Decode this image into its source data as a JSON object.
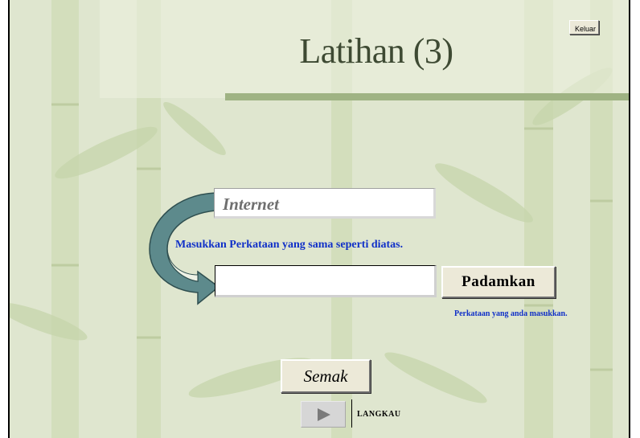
{
  "window": {
    "title": "Latihan (3)"
  },
  "header": {
    "exit_label": "Keluar"
  },
  "exercise": {
    "word": "Internet",
    "instruction": "Masukkan Perkataan yang sama seperti diatas.",
    "input_value": "",
    "clear_label": "Padamkan",
    "hint": "Perkataan yang anda masukkan.",
    "check_label": "Semak"
  },
  "footer": {
    "skip_label": "LANGKAU"
  },
  "colors": {
    "background": "#dfe6cf",
    "title_text": "#3e4a33",
    "instruction_text": "#1030c8",
    "arrow_fill": "#5d8a8c"
  }
}
